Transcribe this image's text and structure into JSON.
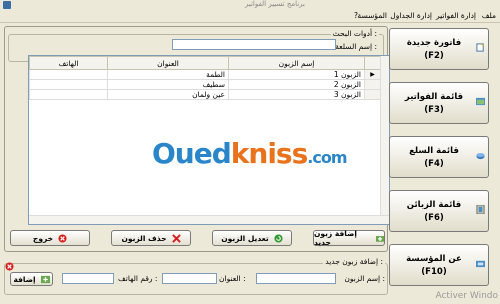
{
  "window": {
    "title": "برنامج تسيير الفواتير"
  },
  "menu": [
    "ملف",
    "إدارة الفواتير",
    "إدارة الجداول",
    "المؤسسة",
    "?"
  ],
  "search": {
    "group_label": "أدوات البحث :",
    "label": "إسم السلعة :",
    "value": ""
  },
  "grid": {
    "columns": [
      "إسم الزبون",
      "العنوان",
      "الهاتف"
    ],
    "rows": [
      {
        "name": "الزبون 1",
        "address": "الطمة",
        "phone": ""
      },
      {
        "name": "الزبون 2",
        "address": "سطيف",
        "phone": ""
      },
      {
        "name": "الزبون 3",
        "address": "عين ولمان",
        "phone": ""
      }
    ]
  },
  "actions": {
    "add": "إضافة زبون جديد",
    "edit": "تعديل الزبون",
    "delete": "حذف الزبون",
    "exit": "خروج"
  },
  "new_customer": {
    "group_label": "إضافة زبون جديد :",
    "name_label": "إسم الزبون :",
    "address_label": "العنوان :",
    "phone_label": "رقم الهاتف :",
    "add_button": "إضافة"
  },
  "sidebar": [
    {
      "line1": "فاتورة جديدة",
      "line2": "(F2)"
    },
    {
      "line1": "قائمة الفواتير",
      "line2": "(F3)"
    },
    {
      "line1": "قائمة السلع",
      "line2": "(F4)"
    },
    {
      "line1": "قائمة الزبائن",
      "line2": "(F6)"
    },
    {
      "line1": "عن المؤسسة",
      "line2": "(F10)"
    }
  ],
  "watermark": {
    "part1": "Oued",
    "part2": "kniss",
    "part3": ".com"
  },
  "activate_text": "Activer Windo",
  "colors": {
    "accent_blue": "#2a86c8",
    "accent_orange": "#e8731c",
    "delete_red": "#d62020",
    "add_green": "#2f9a2f"
  }
}
